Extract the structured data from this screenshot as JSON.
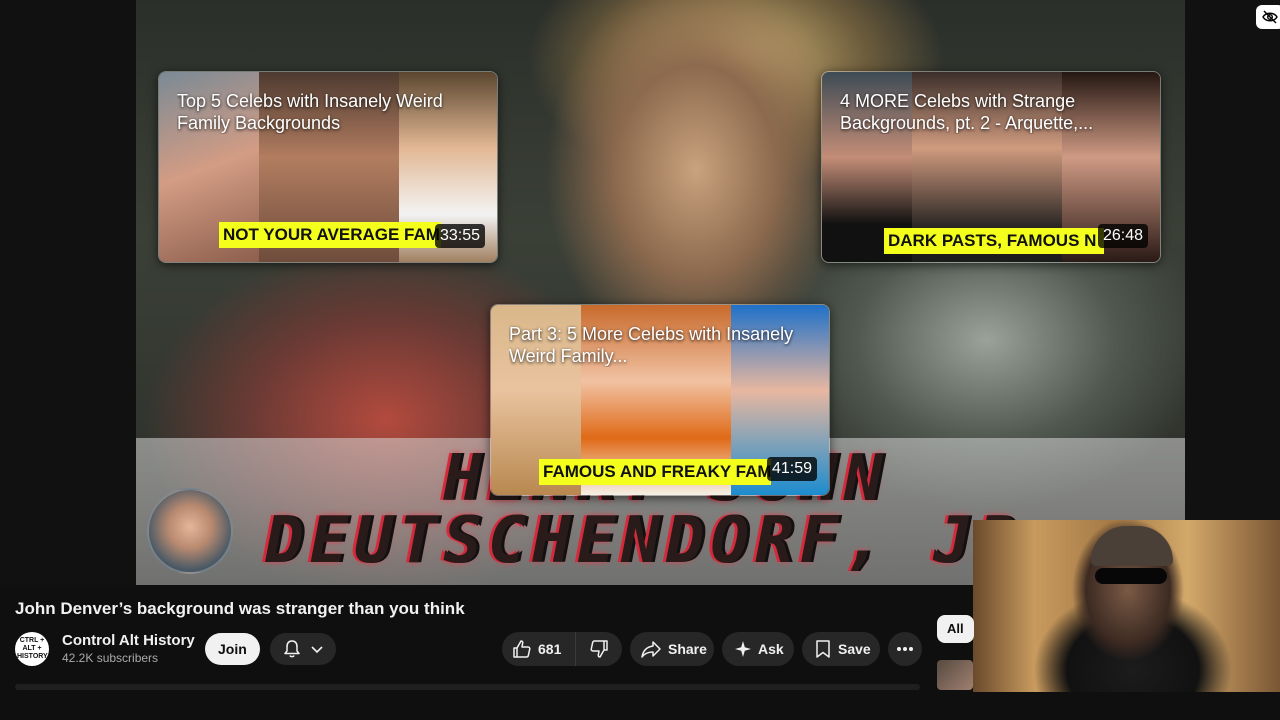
{
  "video": {
    "overlay_title": "HENRY JOHN DEUTSCHENDORF, JR.",
    "title": "John Denver’s background was stranger than you think"
  },
  "end_cards": [
    {
      "title": "Top 5 Celebs with Insanely Weird Family Backgrounds",
      "banner": "NOT YOUR AVERAGE FAM",
      "duration": "33:55"
    },
    {
      "title": "4 MORE Celebs with Strange Backgrounds, pt. 2 - Arquette,...",
      "banner": "DARK PASTS, FAMOUS N",
      "duration": "26:48"
    },
    {
      "title": "Part 3: 5 More Celebs with Insanely Weird Family...",
      "banner": "FAMOUS AND FREAKY FAM",
      "duration": "41:59"
    }
  ],
  "channel": {
    "logo_text": "CTRL + ALT + HISTORY",
    "name": "Control Alt History",
    "subscribers": "42.2K subscribers",
    "join_label": "Join"
  },
  "actions": {
    "likes": "681",
    "share_label": "Share",
    "ask_label": "Ask",
    "save_label": "Save"
  },
  "chips": {
    "all_label": "All"
  },
  "icons": {
    "like": "thumbs-up-icon",
    "dislike": "thumbs-down-icon",
    "share": "share-arrow-icon",
    "ask": "sparkle-icon",
    "save": "bookmark-icon",
    "more": "more-dots-icon",
    "bell": "bell-icon",
    "annotations": "hide-annotations-icon"
  },
  "colors": {
    "banner": "#f4ff1c",
    "background": "#0f0f0f",
    "pill": "#272727"
  }
}
